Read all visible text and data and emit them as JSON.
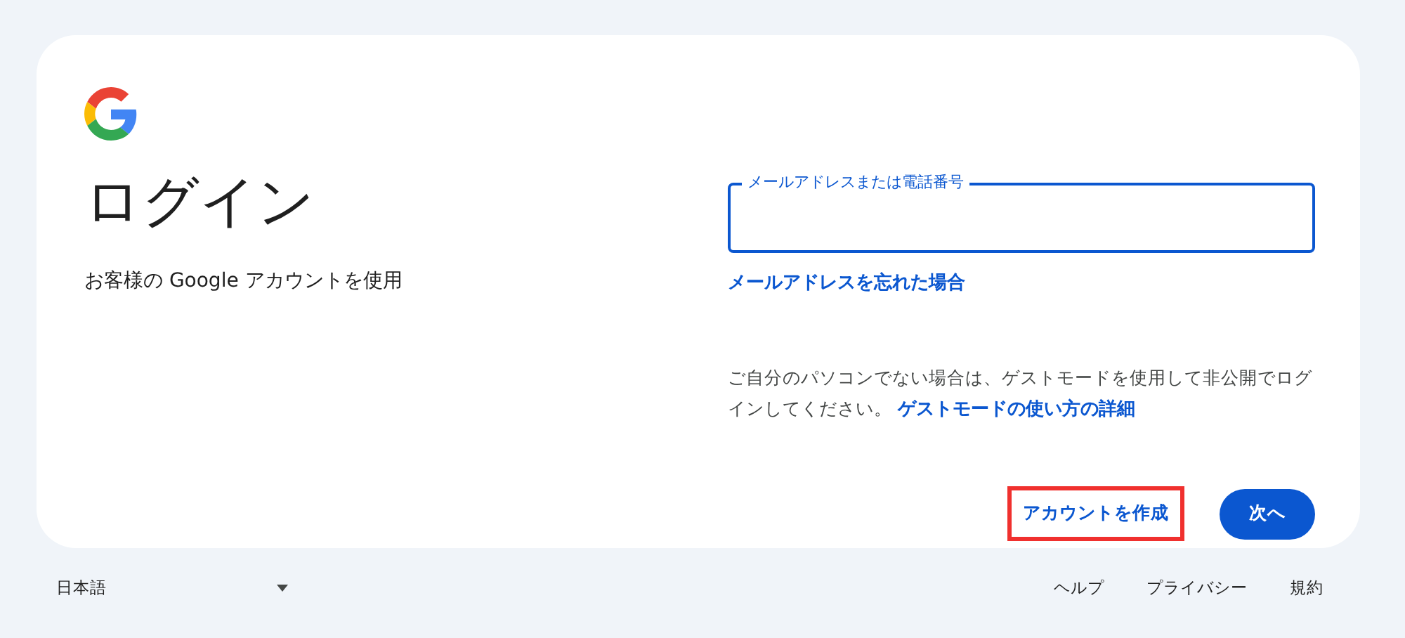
{
  "header": {
    "title": "ログイン",
    "subtitle": "お客様の Google アカウントを使用"
  },
  "email_field": {
    "label": "メールアドレスまたは電話番号",
    "focused": true
  },
  "forgot_link": "メールアドレスを忘れた場合",
  "guest_note": {
    "text": "ご自分のパソコンでない場合は、ゲストモードを使用して非公開でログインしてください。",
    "link": "ゲストモードの使い方の詳細"
  },
  "actions": [
    {
      "kind": "text",
      "label": "アカウントを作成",
      "highlighted": true
    },
    {
      "kind": "filled",
      "label": "次へ",
      "highlighted": false
    }
  ],
  "footer": {
    "language": "日本語",
    "links": [
      "ヘルプ",
      "プライバシー",
      "規約"
    ]
  }
}
